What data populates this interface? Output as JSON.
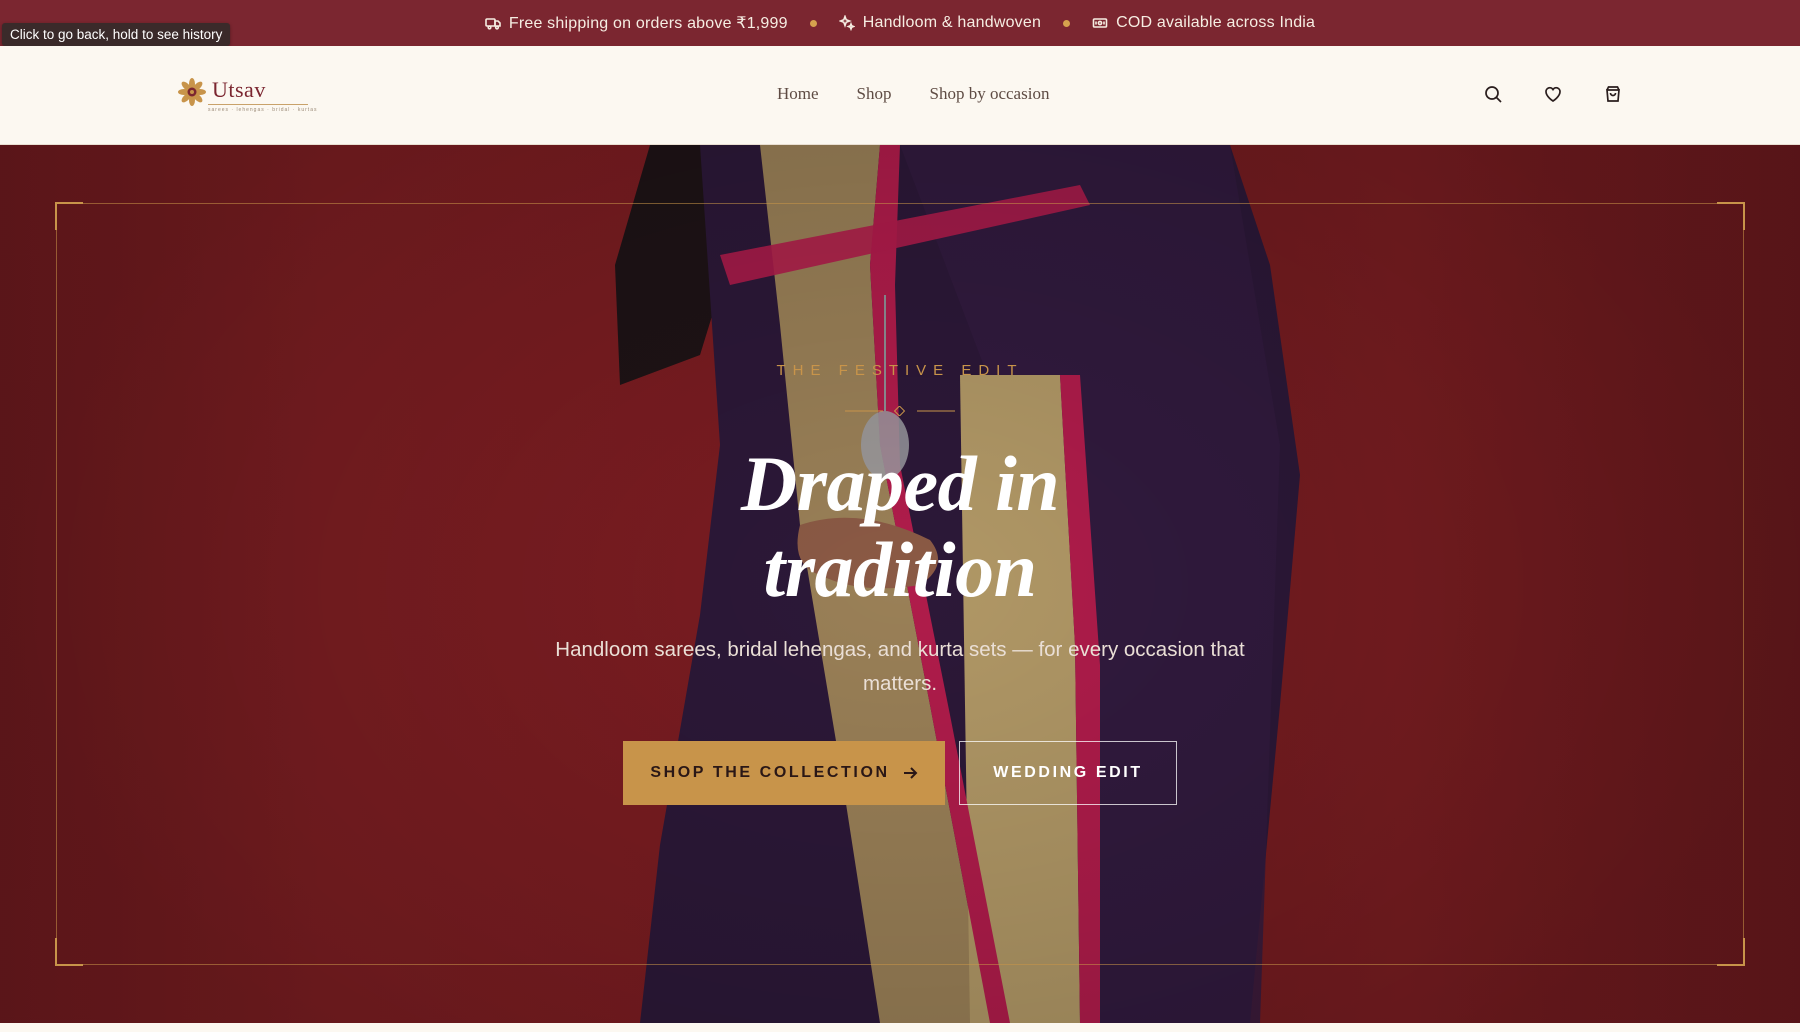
{
  "announcement": {
    "items": [
      {
        "icon": "truck-icon",
        "text": "Free shipping on orders above ₹1,999"
      },
      {
        "icon": "sparkle-icon",
        "text": "Handloom & handwoven"
      },
      {
        "icon": "cash-icon",
        "text": "COD available across India"
      }
    ],
    "dot_color": "#D6A24E"
  },
  "tooltip": "Click to go back, hold to see history",
  "header": {
    "logo_text": "Utsav",
    "logo_tagline": "sarees · lehengas · bridal · kurtas",
    "nav": [
      "Home",
      "Shop",
      "Shop by occasion"
    ],
    "icons": [
      "search-icon",
      "heart-icon",
      "bag-icon"
    ]
  },
  "hero": {
    "eyebrow": "THE FESTIVE EDIT",
    "title_line1": "Draped in",
    "title_line2": "tradition",
    "subtitle": "Handloom sarees, bridal lehengas, and kurta sets — for every occasion that matters.",
    "primary_cta": "SHOP THE COLLECTION",
    "secondary_cta": "WEDDING EDIT"
  },
  "colors": {
    "brand_maroon": "#7B2630",
    "accent_gold": "#C8944A",
    "cream": "#FCF8F1"
  }
}
